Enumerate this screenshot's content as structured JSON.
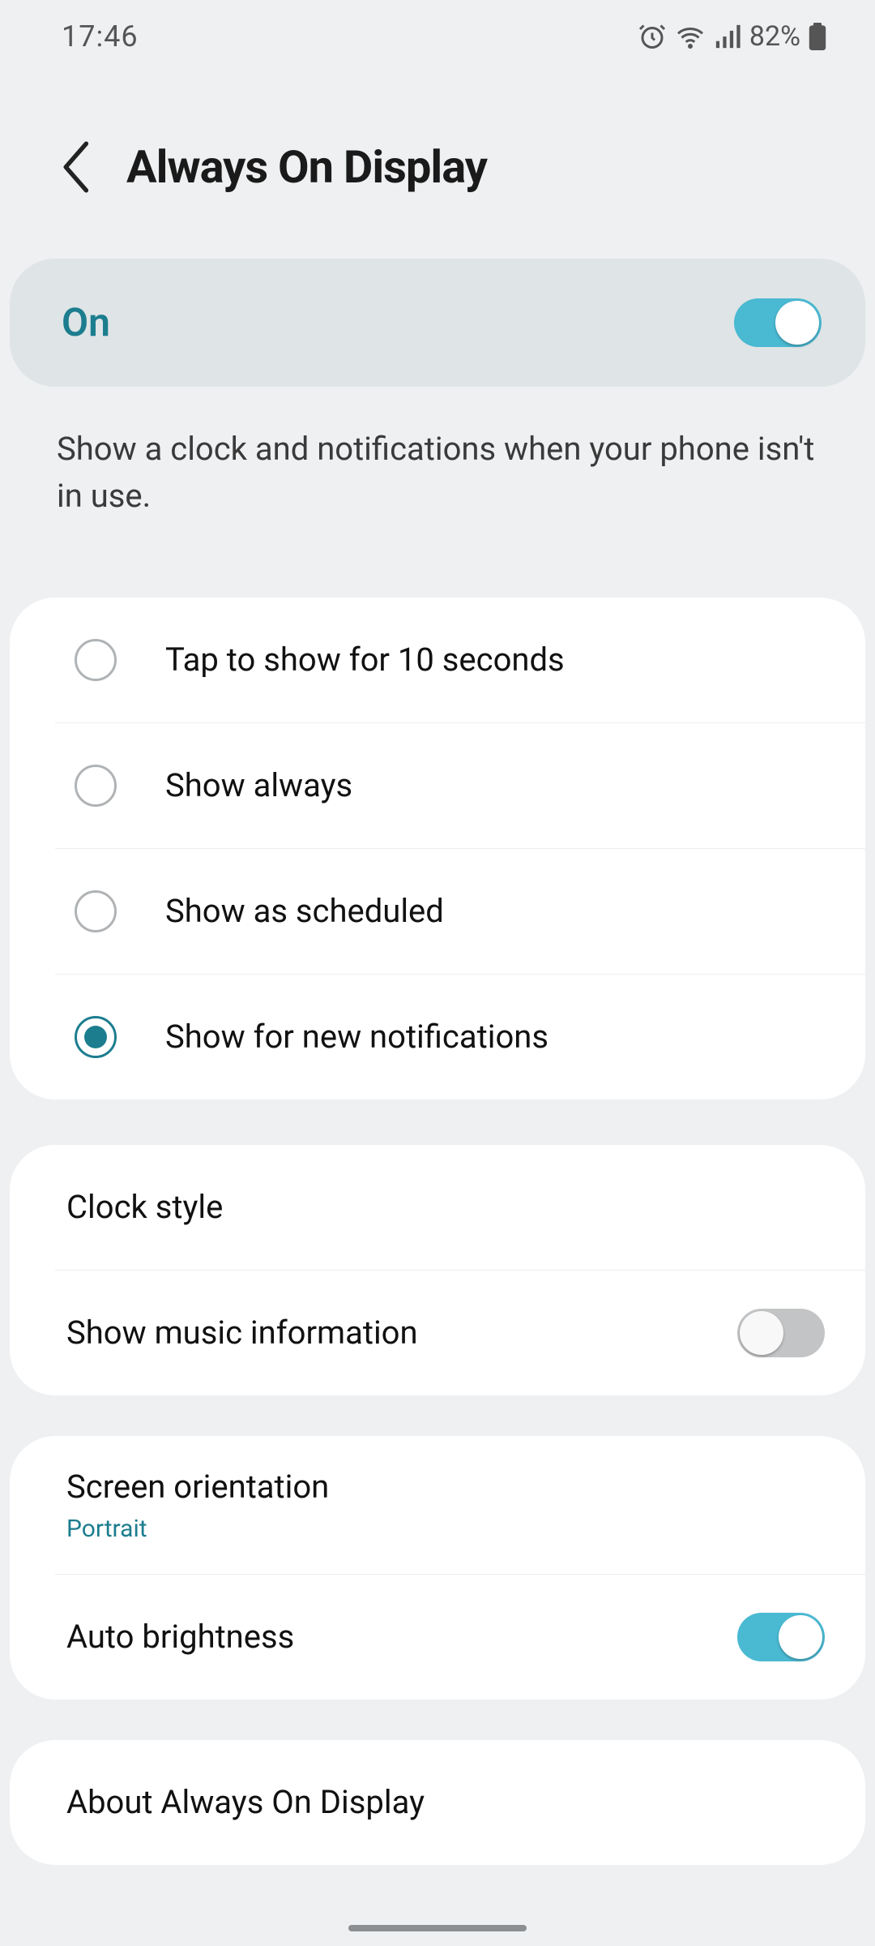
{
  "status": {
    "time": "17:46",
    "battery": "82%"
  },
  "header": {
    "title": "Always On Display"
  },
  "main_toggle": {
    "label": "On",
    "value": true
  },
  "description": "Show a clock and notifications when your phone isn't in use.",
  "modes": {
    "selected_index": 3,
    "options": [
      {
        "label": "Tap to show for 10 seconds"
      },
      {
        "label": "Show always"
      },
      {
        "label": "Show as scheduled"
      },
      {
        "label": "Show for new notifications"
      }
    ]
  },
  "style_group": {
    "clock_style": "Clock style",
    "music_info": {
      "label": "Show music information",
      "value": false
    }
  },
  "display_group": {
    "orientation": {
      "label": "Screen orientation",
      "value": "Portrait"
    },
    "auto_brightness": {
      "label": "Auto brightness",
      "value": true
    }
  },
  "about": {
    "label": "About Always On Display"
  }
}
